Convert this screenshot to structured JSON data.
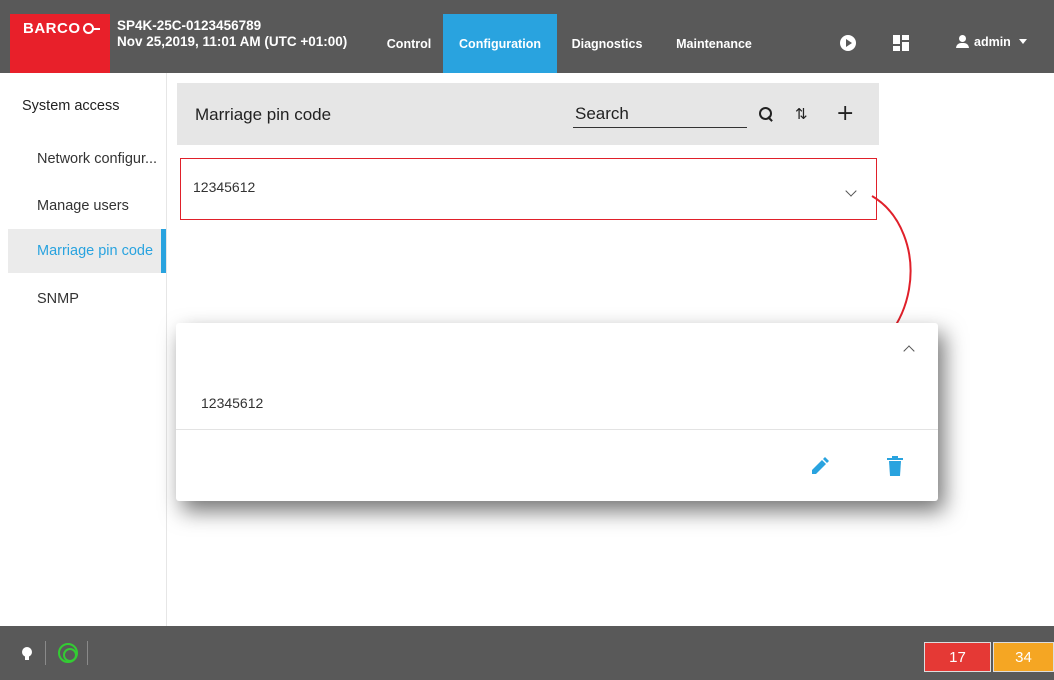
{
  "topbar": {
    "logo_text": "BARCO",
    "device_name": "SP4K-25C-0123456789",
    "device_datetime": "Nov 25,2019, 11:01 AM (UTC +01:00)",
    "nav": {
      "control": "Control",
      "configuration": "Configuration",
      "diagnostics": "Diagnostics",
      "maintenance": "Maintenance"
    },
    "user": "admin"
  },
  "sidebar": {
    "title": "System access",
    "items": [
      {
        "label": "Network configur..."
      },
      {
        "label": "Manage users"
      },
      {
        "label": "Marriage pin code"
      },
      {
        "label": "SNMP"
      }
    ]
  },
  "list": {
    "title": "Marriage pin code",
    "search_placeholder": "Search",
    "row_value": "12345612"
  },
  "card": {
    "value": "12345612"
  },
  "status": {
    "error_count": "17",
    "warning_count": "34"
  },
  "colors": {
    "accent": "#29a3df",
    "brand": "#e8202a",
    "highlight_border": "#e0202a",
    "error": "#e53935",
    "warning": "#f5a623"
  }
}
